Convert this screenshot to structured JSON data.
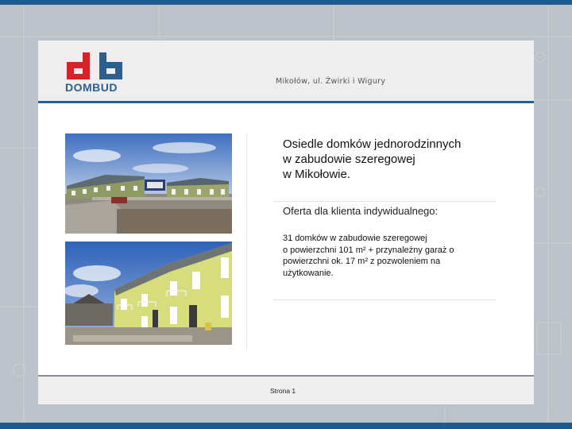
{
  "header": {
    "logo_text": "DOMBUD",
    "location": "Mikołów, ul. Żwirki i Wigury"
  },
  "content": {
    "title_line1": "Osiedle domków jednorodzinnych",
    "title_line2": "w zabudowie szeregowej",
    "title_line3": "w Mikołowie.",
    "offer_heading": "Oferta dla klienta indywidualnego:",
    "desc_line1": "31 domków w zabudowie szeregowej",
    "desc_line2": "o powierzchni 101 m² + przynależny garaż o",
    "desc_line3": "powierzchni ok. 17 m² z pozwoleniem na",
    "desc_line4": "użytkowanie."
  },
  "footer": {
    "page_label": "Strona 1"
  },
  "colors": {
    "brand_blue": "#2a5f8f",
    "brand_red": "#d6232a",
    "frame_blue": "#1f5a8f"
  }
}
